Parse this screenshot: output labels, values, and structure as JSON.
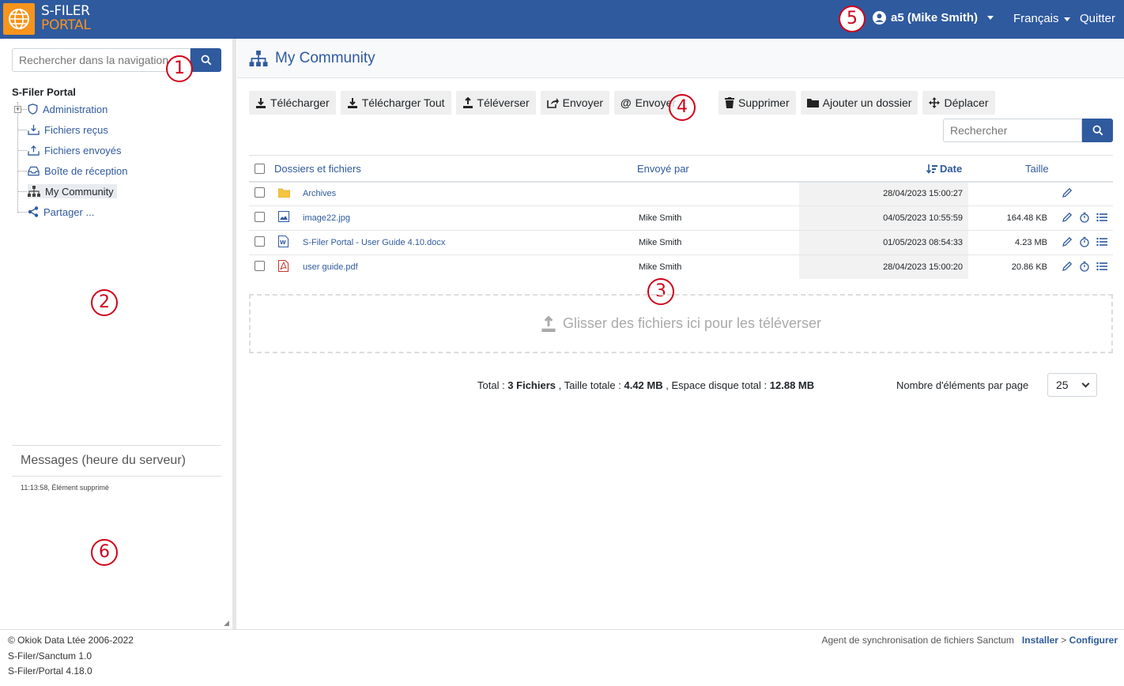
{
  "header": {
    "logo_line1": "S-FILER",
    "logo_line2": "PORTAL",
    "user": "a5 (Mike Smith)",
    "language": "Français",
    "quit": "Quitter"
  },
  "callouts": {
    "c1": "1",
    "c2": "2",
    "c3": "3",
    "c4": "4",
    "c5": "5",
    "c6": "6"
  },
  "sidebar": {
    "search_placeholder": "Rechercher dans la navigation",
    "root": "S-Filer Portal",
    "items": [
      {
        "label": "Administration",
        "icon": "shield-icon"
      },
      {
        "label": "Fichiers reçus",
        "icon": "inbox-download-icon"
      },
      {
        "label": "Fichiers envoyés",
        "icon": "inbox-upload-icon"
      },
      {
        "label": "Boîte de réception",
        "icon": "inbox-icon"
      },
      {
        "label": "My Community",
        "icon": "sitemap-icon"
      },
      {
        "label": "Partager ...",
        "icon": "share-icon"
      }
    ],
    "messages_title": "Messages (heure du serveur)",
    "message_line": "11:13:58, Élément supprimé"
  },
  "main": {
    "title": "My Community",
    "toolbar": [
      {
        "label": "Télécharger",
        "icon": "download-icon"
      },
      {
        "label": "Télécharger Tout",
        "icon": "download-all-icon"
      },
      {
        "label": "Téléverser",
        "icon": "upload-icon"
      },
      {
        "label": "Envoyer",
        "icon": "share-out-icon"
      },
      {
        "label": "Envoyer",
        "icon": "at-icon"
      },
      {
        "label": "Supprimer",
        "icon": "trash-icon"
      },
      {
        "label": "Ajouter un dossier",
        "icon": "folder-icon"
      },
      {
        "label": "Déplacer",
        "icon": "move-icon"
      }
    ],
    "search_placeholder": "Rechercher",
    "columns": {
      "name": "Dossiers et fichiers",
      "sent_by": "Envoyé par",
      "date": "Date",
      "size": "Taille"
    },
    "rows": [
      {
        "name": "Archives",
        "type": "folder",
        "sent_by": "",
        "date": "28/04/2023 15:00:27",
        "size": ""
      },
      {
        "name": "image22.jpg",
        "type": "image",
        "sent_by": "Mike Smith",
        "date": "04/05/2023 10:55:59",
        "size": "164.48 KB"
      },
      {
        "name": "S-Filer Portal - User Guide 4.10.docx",
        "type": "word",
        "sent_by": "Mike Smith",
        "date": "01/05/2023 08:54:33",
        "size": "4.23 MB"
      },
      {
        "name": "user guide.pdf",
        "type": "pdf",
        "sent_by": "Mike Smith",
        "date": "28/04/2023 15:00:20",
        "size": "20.86 KB"
      }
    ],
    "dropzone": "Glisser des fichiers ici pour les téléverser",
    "totals": {
      "total_label": "Total : ",
      "files": "3 Fichiers",
      "size_label": " , Taille totale : ",
      "size": "4.42 MB",
      "disk_label": " , Espace disque total : ",
      "disk": "12.88 MB"
    },
    "per_page_label": "Nombre d'éléments par page",
    "per_page_value": "25"
  },
  "footer": {
    "copyright": "© Okiok Data Ltée 2006-2022",
    "sanctum": "S-Filer/Sanctum 1.0",
    "portal": "S-Filer/Portal 4.18.0",
    "agent_text": "Agent de synchronisation de fichiers Sanctum",
    "install": "Installer",
    "sep": ">",
    "configure": "Configurer"
  }
}
